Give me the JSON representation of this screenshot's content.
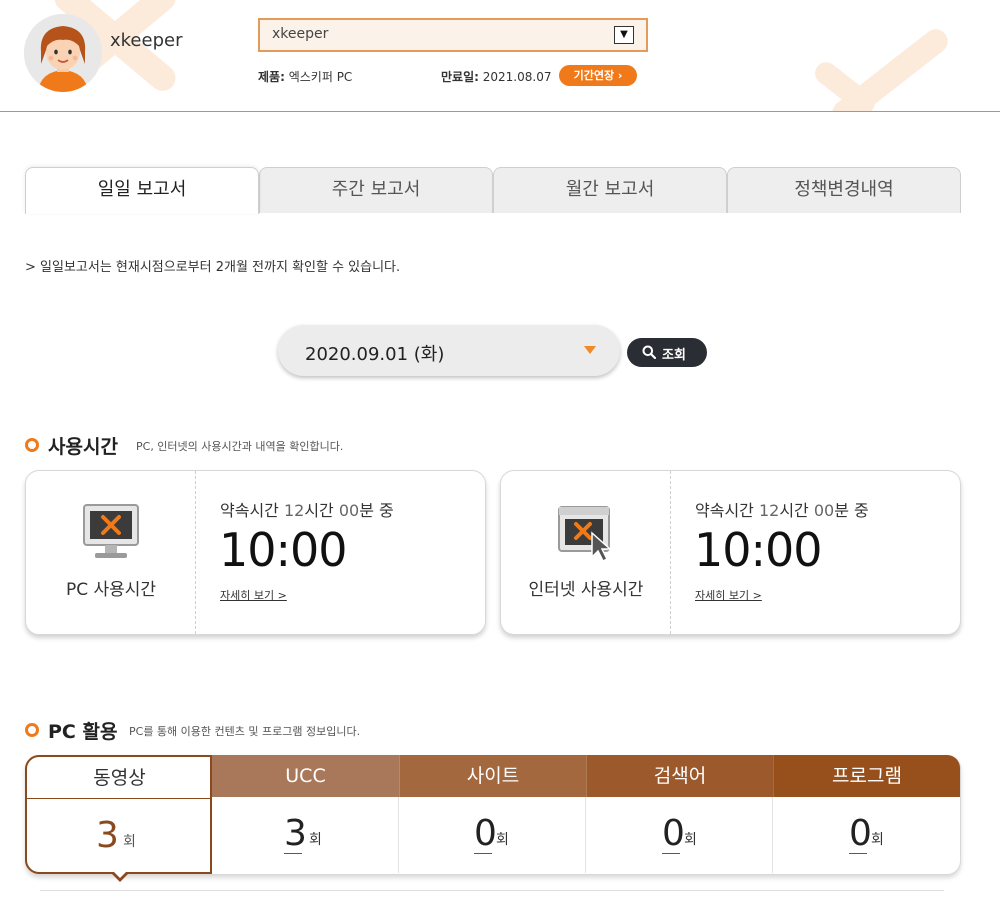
{
  "header": {
    "username": "xkeeper",
    "account_select_value": "xkeeper",
    "product_label": "제품:",
    "product_value": "엑스키퍼 PC",
    "expire_label": "만료일:",
    "expire_value": "2021.08.07",
    "extend_button": "기간연장 ›"
  },
  "tabs": [
    {
      "label": "일일 보고서",
      "active": true
    },
    {
      "label": "주간 보고서",
      "active": false
    },
    {
      "label": "월간 보고서",
      "active": false
    },
    {
      "label": "정책변경내역",
      "active": false
    }
  ],
  "notice": "> 일일보고서는 현재시점으로부터 2개월 전까지 확인할 수 있습니다.",
  "date_filter": {
    "selected": "2020.09.01 (화)",
    "search_button": "조회"
  },
  "usage": {
    "title": "사용시간",
    "desc": "PC, 인터넷의 사용시간과 내역을 확인합니다.",
    "cards": [
      {
        "caption": "PC 사용시간",
        "promise_prefix": "약속시간 ",
        "promise_hours": "12",
        "promise_h_unit": "시간 ",
        "promise_mins": "00",
        "promise_suffix": "분 중",
        "time": "10:00",
        "more": "자세히 보기 >",
        "icon": "monitor-icon"
      },
      {
        "caption": "인터넷 사용시간",
        "promise_prefix": "약속시간 ",
        "promise_hours": "12",
        "promise_h_unit": "시간 ",
        "promise_mins": "00",
        "promise_suffix": "분 중",
        "time": "10:00",
        "more": "자세히 보기 >",
        "icon": "browser-cursor-icon"
      }
    ]
  },
  "activity": {
    "title": "PC 활용",
    "desc": "PC를 통해 이용한 컨텐츠 및 프로그램 정보입니다.",
    "columns": [
      {
        "label": "동영상",
        "count": "3",
        "unit": "회",
        "color": "#ffffff"
      },
      {
        "label": "UCC",
        "count": "3",
        "unit": "회",
        "color": "#a9785a"
      },
      {
        "label": "사이트",
        "count": "0",
        "unit": "회",
        "color": "#a3683e"
      },
      {
        "label": "검색어",
        "count": "0",
        "unit": "회",
        "color": "#9c5a2c"
      },
      {
        "label": "프로그램",
        "count": "0",
        "unit": "회",
        "color": "#97501c"
      }
    ]
  },
  "colors": {
    "accent": "#f07a1a",
    "dark_button": "#2a2d33",
    "active_border": "#8a4a1e"
  }
}
